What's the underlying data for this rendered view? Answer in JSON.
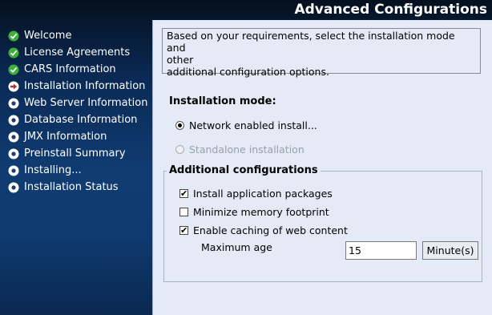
{
  "window": {
    "title": "Advanced Configurations"
  },
  "steps": [
    {
      "label": "Welcome",
      "status": "done"
    },
    {
      "label": "License Agreements",
      "status": "done"
    },
    {
      "label": "CARS Information",
      "status": "done"
    },
    {
      "label": "Installation Information",
      "status": "current"
    },
    {
      "label": "Web Server Information",
      "status": "pending"
    },
    {
      "label": "Database Information",
      "status": "pending"
    },
    {
      "label": "JMX Information",
      "status": "pending"
    },
    {
      "label": "Preinstall Summary",
      "status": "pending"
    },
    {
      "label": "Installing...",
      "status": "pending"
    },
    {
      "label": "Installation Status",
      "status": "pending"
    }
  ],
  "description": {
    "line1": "Based on your requirements, select the installation mode and",
    "line2": "other",
    "line3": "additional configuration options."
  },
  "install_mode": {
    "heading": "Installation mode:",
    "options": [
      {
        "label": "Network enabled install...",
        "selected": true,
        "enabled": true
      },
      {
        "label": "Standalone installation",
        "selected": false,
        "enabled": false
      }
    ]
  },
  "additional": {
    "heading": "Additional configurations",
    "options": [
      {
        "label": "Install application packages",
        "checked": true
      },
      {
        "label": "Minimize memory footprint",
        "checked": false
      },
      {
        "label": "Enable caching of web content",
        "checked": true
      }
    ],
    "max_age": {
      "label": "Maximum age",
      "value": "15",
      "unit": "Minute(s)"
    }
  },
  "colors": {
    "done": "#3cae3c",
    "current": "#c0282a",
    "panel": "#e4ebf6"
  }
}
